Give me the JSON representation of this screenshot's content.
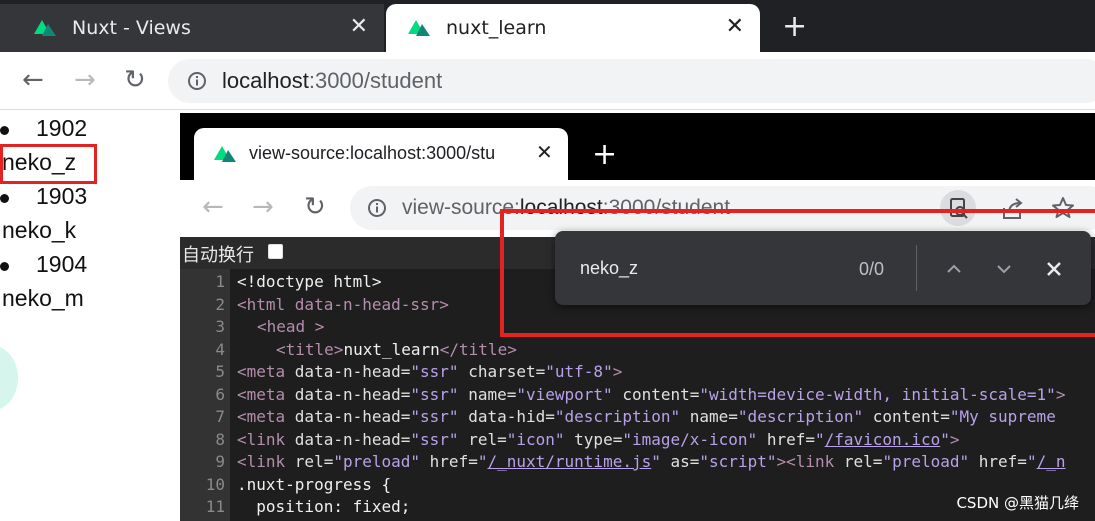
{
  "outer_browser": {
    "tabs": [
      {
        "title": "Nuxt - Views",
        "close": "✕"
      },
      {
        "title": "nuxt_learn",
        "close": "✕"
      }
    ],
    "new_tab": "+",
    "nav": {
      "back": "←",
      "forward": "→",
      "reload": "↻"
    },
    "address": {
      "host": "localhost",
      "path": ":3000/student"
    }
  },
  "page": {
    "items": [
      {
        "grade": "1902",
        "name": "neko_z"
      },
      {
        "grade": "1903",
        "name": "neko_k"
      },
      {
        "grade": "1904",
        "name": "neko_m"
      }
    ]
  },
  "inner_browser": {
    "tab": {
      "title": "view-source:localhost:3000/stu",
      "close": "✕"
    },
    "new_tab": "+",
    "nav": {
      "back": "←",
      "forward": "→",
      "reload": "↻"
    },
    "address": {
      "prefix": "view-source:",
      "host": "localhost",
      "path": ":3000/student"
    },
    "wrap_label": "自动换行",
    "line_numbers": [
      "1",
      "2",
      "3",
      "4",
      "5",
      "6",
      "7",
      "8",
      "9",
      "10",
      "11"
    ],
    "code": {
      "l1": "<!doctype html>",
      "l2_tag": "<html ",
      "l2_attr": "data-n-head-ssr",
      "l2_end": ">",
      "l3": "<head >",
      "l4_open": "<title>",
      "l4_text": "nuxt_learn",
      "l4_close": "</title>",
      "l5_tag": "<meta ",
      "l5_a1": "data-n-head=",
      "l5_v1": "\"ssr\"",
      "l5_a2": " charset=",
      "l5_v2": "\"utf-8\"",
      "l5_end": ">",
      "l6_tag": "<meta ",
      "l6_a1": "data-n-head=",
      "l6_v1": "\"ssr\"",
      "l6_a2": " name=",
      "l6_v2": "\"viewport\"",
      "l6_a3": " content=",
      "l6_v3": "\"width=device-width, initial-scale=1\"",
      "l6_end": ">",
      "l7_tag": "<meta ",
      "l7_a1": "data-n-head=",
      "l7_v1": "\"ssr\"",
      "l7_a2": " data-hid=",
      "l7_v2": "\"description\"",
      "l7_a3": " name=",
      "l7_v3": "\"description\"",
      "l7_a4": " content=",
      "l7_v4": "\"My supreme",
      "l8_tag": "<link ",
      "l8_a1": "data-n-head=",
      "l8_v1": "\"ssr\"",
      "l8_a2": " rel=",
      "l8_v2": "\"icon\"",
      "l8_a3": " type=",
      "l8_v3": "\"image/x-icon\"",
      "l8_a4": " href=",
      "l8_q1": "\"",
      "l8_link": "/favicon.ico",
      "l8_q2": "\"",
      "l8_end": ">",
      "l9_tag": "<link ",
      "l9_a1": "rel=",
      "l9_v1": "\"preload\"",
      "l9_a2": " href=",
      "l9_q1": "\"",
      "l9_link": "/_nuxt/runtime.js",
      "l9_q2": "\"",
      "l9_a3": " as=",
      "l9_v3": "\"script\"",
      "l9_tag2": "><link ",
      "l9_a4": "rel=",
      "l9_v4": "\"preload\"",
      "l9_a5": " href=",
      "l9_q3": "\"",
      "l9_link2": "/_n",
      "l10": ".nuxt-progress {",
      "l11": "  position: fixed;"
    }
  },
  "find_bar": {
    "query": "neko_z",
    "count": "0/0",
    "prev": "⌃",
    "next": "⌄",
    "close": "✕"
  },
  "watermark": "CSDN @黑猫几绛",
  "colors": {
    "nuxt_green": "#00dc82",
    "nuxt_dark": "#108775",
    "annotation_red": "#e32222"
  }
}
